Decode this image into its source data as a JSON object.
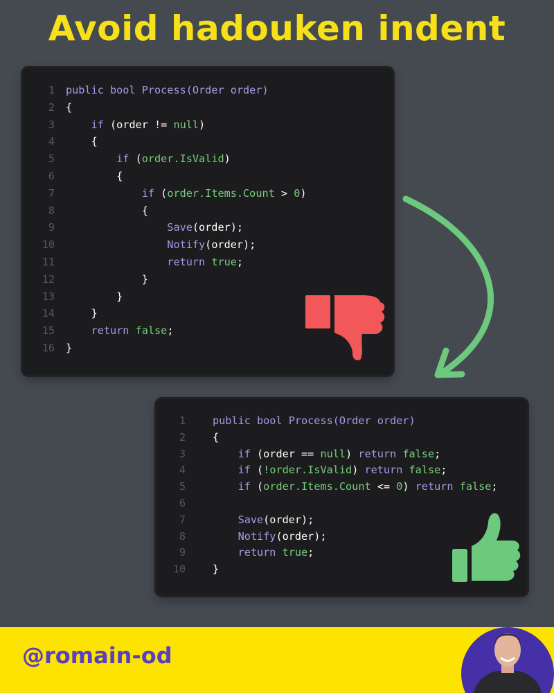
{
  "title": "Avoid hadouken indent",
  "handle": "@romain-od",
  "colors": {
    "background": "#454950",
    "title": "#f6e01a",
    "footer": "#fde400",
    "handle": "#5a3fbf",
    "keyword": "#a59ae8",
    "literal": "#78cf7c",
    "bad": "#f2575a",
    "good": "#6cc97e"
  },
  "icons": {
    "bad_example": "thumbs-down-icon",
    "good_example": "thumbs-up-icon",
    "transition": "curved-arrow-icon",
    "author": "author-photo"
  },
  "bad_code": [
    {
      "n": "1",
      "t": [
        [
          "public bool Process(Order order)",
          "kw"
        ]
      ]
    },
    {
      "n": "2",
      "t": [
        [
          "{",
          ""
        ]
      ]
    },
    {
      "n": "3",
      "t": [
        [
          "    if",
          "kw"
        ],
        [
          " (order != ",
          ""
        ],
        [
          "null",
          "lit"
        ],
        [
          ")",
          ""
        ]
      ]
    },
    {
      "n": "4",
      "t": [
        [
          "    {",
          ""
        ]
      ]
    },
    {
      "n": "5",
      "t": [
        [
          "        if",
          "kw"
        ],
        [
          " (",
          ""
        ],
        [
          "order.IsValid",
          "lit"
        ],
        [
          ")",
          ""
        ]
      ]
    },
    {
      "n": "6",
      "t": [
        [
          "        {",
          ""
        ]
      ]
    },
    {
      "n": "7",
      "t": [
        [
          "            if",
          "kw"
        ],
        [
          " (",
          ""
        ],
        [
          "order.Items.Count",
          "lit"
        ],
        [
          " > ",
          ""
        ],
        [
          "0",
          "lit"
        ],
        [
          ")",
          ""
        ]
      ]
    },
    {
      "n": "8",
      "t": [
        [
          "            {",
          ""
        ]
      ]
    },
    {
      "n": "9",
      "t": [
        [
          "                Save",
          "kw"
        ],
        [
          "(order);",
          ""
        ]
      ]
    },
    {
      "n": "10",
      "t": [
        [
          "                Notify",
          "kw"
        ],
        [
          "(order);",
          ""
        ]
      ]
    },
    {
      "n": "11",
      "t": [
        [
          "                return",
          "kw"
        ],
        [
          " ",
          ""
        ],
        [
          "true",
          "lit"
        ],
        [
          ";",
          ""
        ]
      ]
    },
    {
      "n": "12",
      "t": [
        [
          "            }",
          ""
        ]
      ]
    },
    {
      "n": "13",
      "t": [
        [
          "        }",
          ""
        ]
      ]
    },
    {
      "n": "14",
      "t": [
        [
          "    }",
          ""
        ]
      ]
    },
    {
      "n": "15",
      "t": [
        [
          "    return",
          "kw"
        ],
        [
          " ",
          ""
        ],
        [
          "false",
          "lit"
        ],
        [
          ";",
          ""
        ]
      ]
    },
    {
      "n": "16",
      "t": [
        [
          "}",
          ""
        ]
      ]
    }
  ],
  "good_code": [
    {
      "n": "1",
      "t": [
        [
          "public bool Process(Order order)",
          "kw"
        ]
      ]
    },
    {
      "n": "2",
      "t": [
        [
          "{",
          ""
        ]
      ]
    },
    {
      "n": "3",
      "t": [
        [
          "    if",
          "kw"
        ],
        [
          " (order == ",
          ""
        ],
        [
          "null",
          "lit"
        ],
        [
          ") ",
          ""
        ],
        [
          "return",
          "kw"
        ],
        [
          " ",
          ""
        ],
        [
          "false",
          "lit"
        ],
        [
          ";",
          ""
        ]
      ]
    },
    {
      "n": "4",
      "t": [
        [
          "    if",
          "kw"
        ],
        [
          " (",
          ""
        ],
        [
          "!order.IsValid",
          "lit"
        ],
        [
          ") ",
          ""
        ],
        [
          "return",
          "kw"
        ],
        [
          " ",
          ""
        ],
        [
          "false",
          "lit"
        ],
        [
          ";",
          ""
        ]
      ]
    },
    {
      "n": "5",
      "t": [
        [
          "    if",
          "kw"
        ],
        [
          " (",
          ""
        ],
        [
          "order.Items.Count",
          "lit"
        ],
        [
          " <= ",
          ""
        ],
        [
          "0",
          "lit"
        ],
        [
          ") ",
          ""
        ],
        [
          "return",
          "kw"
        ],
        [
          " ",
          ""
        ],
        [
          "false",
          "lit"
        ],
        [
          ";",
          ""
        ]
      ]
    },
    {
      "n": "6",
      "t": [
        [
          "",
          ""
        ]
      ]
    },
    {
      "n": "7",
      "t": [
        [
          "    Save",
          "kw"
        ],
        [
          "(order);",
          ""
        ]
      ]
    },
    {
      "n": "8",
      "t": [
        [
          "    Notify",
          "kw"
        ],
        [
          "(order);",
          ""
        ]
      ]
    },
    {
      "n": "9",
      "t": [
        [
          "    return",
          "kw"
        ],
        [
          " ",
          ""
        ],
        [
          "true",
          "lit"
        ],
        [
          ";",
          ""
        ]
      ]
    },
    {
      "n": "10",
      "t": [
        [
          "}",
          ""
        ]
      ]
    }
  ]
}
